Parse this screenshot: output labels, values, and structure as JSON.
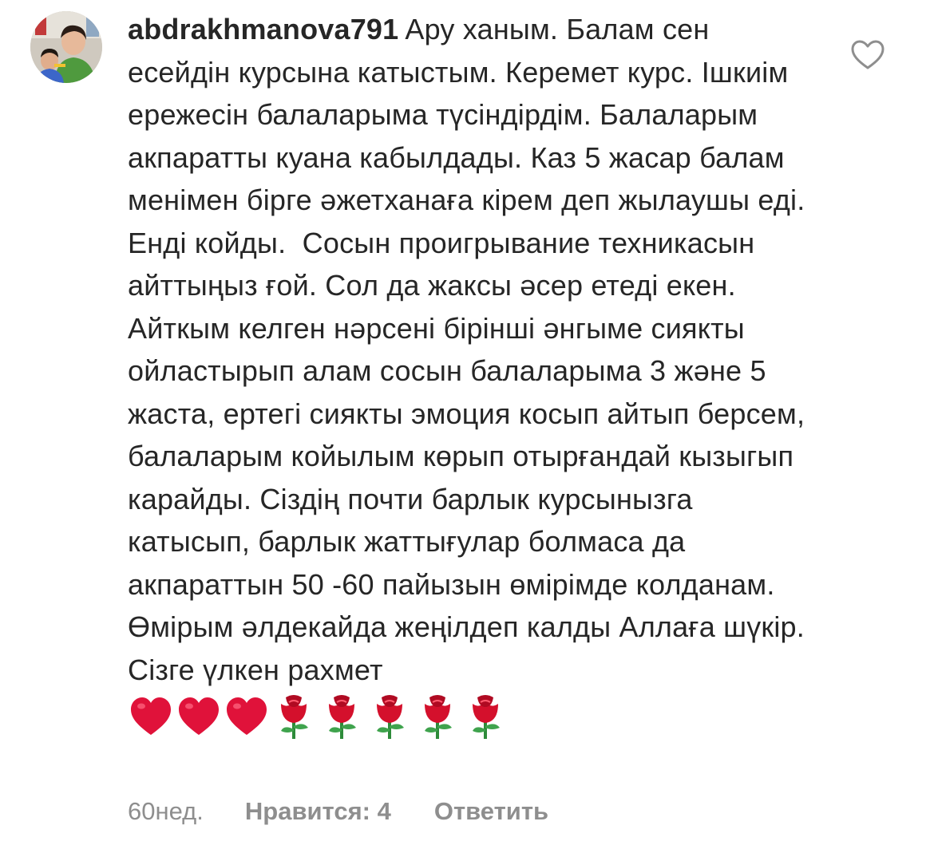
{
  "comment": {
    "username": "abdrakhmanova791",
    "text": "Ару ханым. Балам сен есейдін курсына катыстым. Керемет курс. Ішкиім ережесін балаларыма түсіндірдім. Балаларым акпаратты куана кабылдады. Каз 5 жасар балам менімен бірге әжетханаға кірем деп жылаушы еді. Енді койды.  Сосын проигрывание техникасын айттыңыз ғой. Сол да жаксы әсер етеді екен. Айткым келген нәрсені бірінші әнгыме сиякты ойластырып алам сосын балаларыма 3 және 5 жаста, ертегі сиякты эмоция косып айтып берсем, балаларым койылым көрып отырғандай кызыгып карайды. Сіздің почти барлык курсынызга катысып, барлык жаттығулар болмаса да акпараттын 50 -60 пайызын өмірімде колданам. Өмірым әлдекайда жеңілдеп калды Аллаға шүкір. Сізге үлкен рахмет",
    "emojis": [
      "red-heart",
      "red-heart",
      "red-heart",
      "rose",
      "rose",
      "rose",
      "rose",
      "rose"
    ],
    "time": "60нед.",
    "likes_label": "Нравится: 4",
    "reply_label": "Ответить",
    "like_icon": "heart-outline-icon"
  },
  "colors": {
    "text": "#262626",
    "meta": "#8e8e8e",
    "heart": "#e0123a",
    "rose": "#d4102c",
    "stem": "#2e8b3a"
  }
}
